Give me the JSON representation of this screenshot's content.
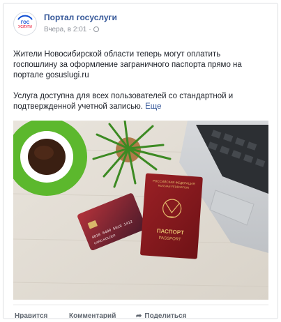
{
  "post": {
    "page_name": "Портал госуслуги",
    "timestamp": "Вчера, в 2:01",
    "privacy_icon": "globe-icon",
    "paragraph1": "Жители Новосибирской области теперь могут оплатить госпошлину за оформление заграничного паспорта прямо на портале gosuslugi.ru",
    "paragraph2": "Услуга доступна для всех пользователей со стандартной и подтвержденной учетной записью.",
    "more_link": "Еще"
  },
  "avatar": {
    "logo_line1": "ГОС",
    "logo_line2": "УСЛУГИ"
  },
  "photo": {
    "passport_title": "ПАСПОРТ",
    "passport_subtitle": "PASSPORT",
    "passport_header_ru": "РОССИЙСКАЯ ФЕДЕРАЦИЯ",
    "passport_header_en": "RUSSIAN FEDERATION",
    "card_number": "4018 6400 5618 1412",
    "card_name": "CARD HOLDER"
  },
  "actions": {
    "like": "Нравится",
    "comment": "Комментарий",
    "share": "Поделиться"
  },
  "colors": {
    "link": "#365899",
    "meta": "#90949c",
    "text": "#1d2129",
    "passport": "#8b1a1e"
  }
}
